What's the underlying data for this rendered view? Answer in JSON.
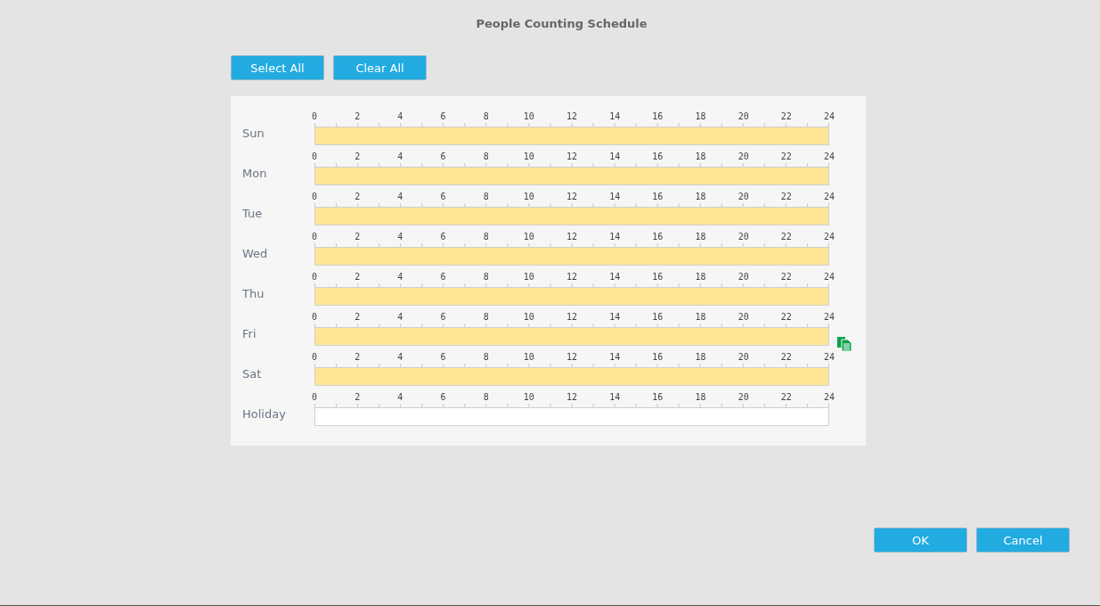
{
  "title": "People Counting Schedule",
  "top_buttons": [
    "Select All",
    "Clear All"
  ],
  "days": [
    {
      "label": "Sun",
      "ticks": [
        "0",
        "2",
        "4",
        "6",
        "8",
        "10",
        "12",
        "14",
        "16",
        "18",
        "20",
        "22",
        "24"
      ],
      "level": 1,
      "copy": false
    },
    {
      "label": "Mon",
      "ticks": [
        "0",
        "2",
        "4",
        "6",
        "8",
        "10",
        "12",
        "14",
        "16",
        "18",
        "20",
        "22",
        "24"
      ],
      "level": 1,
      "copy": false
    },
    {
      "label": "Tue",
      "ticks": [
        "0",
        "2",
        "4",
        "6",
        "8",
        "10",
        "12",
        "14",
        "16",
        "18",
        "20",
        "22",
        "24"
      ],
      "level": 1,
      "copy": false
    },
    {
      "label": "Wed",
      "ticks": [
        "0",
        "2",
        "4",
        "6",
        "8",
        "10",
        "12",
        "14",
        "16",
        "18",
        "20",
        "22",
        "24"
      ],
      "level": 1,
      "copy": false
    },
    {
      "label": "Thu",
      "ticks": [
        "0",
        "2",
        "4",
        "6",
        "8",
        "10",
        "12",
        "14",
        "16",
        "18",
        "20",
        "22",
        "24"
      ],
      "level": 1,
      "copy": false
    },
    {
      "label": "Fri",
      "ticks": [
        "0",
        "2",
        "4",
        "6",
        "8",
        "10",
        "12",
        "14",
        "16",
        "18",
        "20",
        "22",
        "24"
      ],
      "level": 1,
      "copy": true
    },
    {
      "label": "Sat",
      "ticks": [
        "0",
        "2",
        "4",
        "6",
        "8",
        "10",
        "12",
        "14",
        "16",
        "18",
        "20",
        "22",
        "24"
      ],
      "level": 1,
      "copy": false
    },
    {
      "label": "Holiday",
      "ticks": [
        "0",
        "2",
        "4",
        "6",
        "8",
        "10",
        "12",
        "14",
        "16",
        "18",
        "20",
        "22",
        "24"
      ],
      "level": 0,
      "copy": false
    }
  ],
  "bottom_buttons": [
    "OK",
    "Cancel"
  ]
}
